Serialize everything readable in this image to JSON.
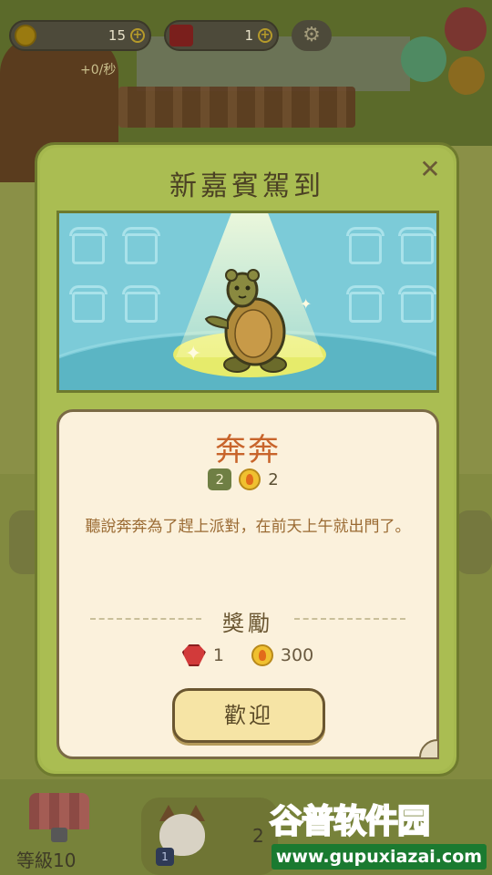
{
  "hud": {
    "coin_value": "15",
    "gem_value": "1",
    "plus_symbol": "+",
    "rate": "+0/秒",
    "settings_icon": "gear-icon"
  },
  "modal": {
    "title": "新嘉賓駕到",
    "close_symbol": "✕"
  },
  "guest": {
    "name": "奔奔",
    "level": "2",
    "coin_cost": "2",
    "description": "聽說奔奔為了趕上派對，在前天上午就出門了。"
  },
  "reward": {
    "title": "獎勵",
    "gems": "1",
    "coins": "300"
  },
  "welcome_button": "歡迎",
  "bottom": {
    "level_label": "等級10",
    "cat_badge": "1",
    "cat_count": "2"
  },
  "watermark": {
    "title_chars": [
      "谷",
      "普",
      "软",
      "件",
      "园"
    ],
    "url": "www.gupuxiazai.com"
  },
  "colors": {
    "modal_bg": "#aabd52",
    "guest_name": "#c8642b",
    "description": "#9a6a32",
    "stage_bg": "#7ccbd8",
    "watermark_green": "#1a8a3a"
  }
}
